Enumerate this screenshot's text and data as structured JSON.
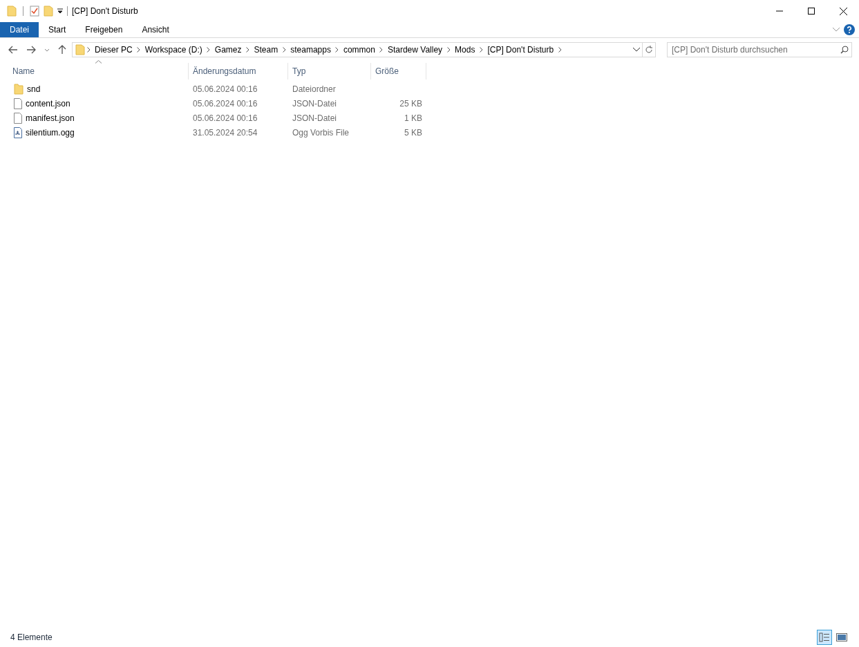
{
  "window": {
    "title": "[CP] Don't Disturb"
  },
  "ribbon_tabs": [
    {
      "label": "Datei",
      "selected": true
    },
    {
      "label": "Start",
      "selected": false
    },
    {
      "label": "Freigeben",
      "selected": false
    },
    {
      "label": "Ansicht",
      "selected": false
    }
  ],
  "breadcrumb": [
    "Dieser PC",
    "Workspace (D:)",
    "Gamez",
    "Steam",
    "steamapps",
    "common",
    "Stardew Valley",
    "Mods",
    "[CP] Don't Disturb"
  ],
  "search": {
    "placeholder": "[CP] Don't Disturb durchsuchen"
  },
  "table": {
    "columns": [
      "Name",
      "Änderungsdatum",
      "Typ",
      "Größe"
    ],
    "rows": [
      {
        "kind": "folder",
        "name": "snd",
        "date": "05.06.2024 00:16",
        "type": "Dateiordner"
      },
      {
        "kind": "file",
        "name": "content.json",
        "date": "05.06.2024 00:16",
        "type": "JSON-Datei",
        "size": "25 KB"
      },
      {
        "kind": "file",
        "name": "manifest.json",
        "date": "05.06.2024 00:16",
        "type": "JSON-Datei",
        "size": "1 KB"
      },
      {
        "kind": "audio",
        "name": "silentium.ogg",
        "date": "31.05.2024 20:54",
        "type": "Ogg Vorbis File",
        "size": "5 KB"
      }
    ]
  },
  "status_bar": {
    "text": "4 Elemente",
    "views": [
      {
        "kind": "details",
        "selected": true
      },
      {
        "kind": "tiles",
        "selected": false
      }
    ]
  }
}
